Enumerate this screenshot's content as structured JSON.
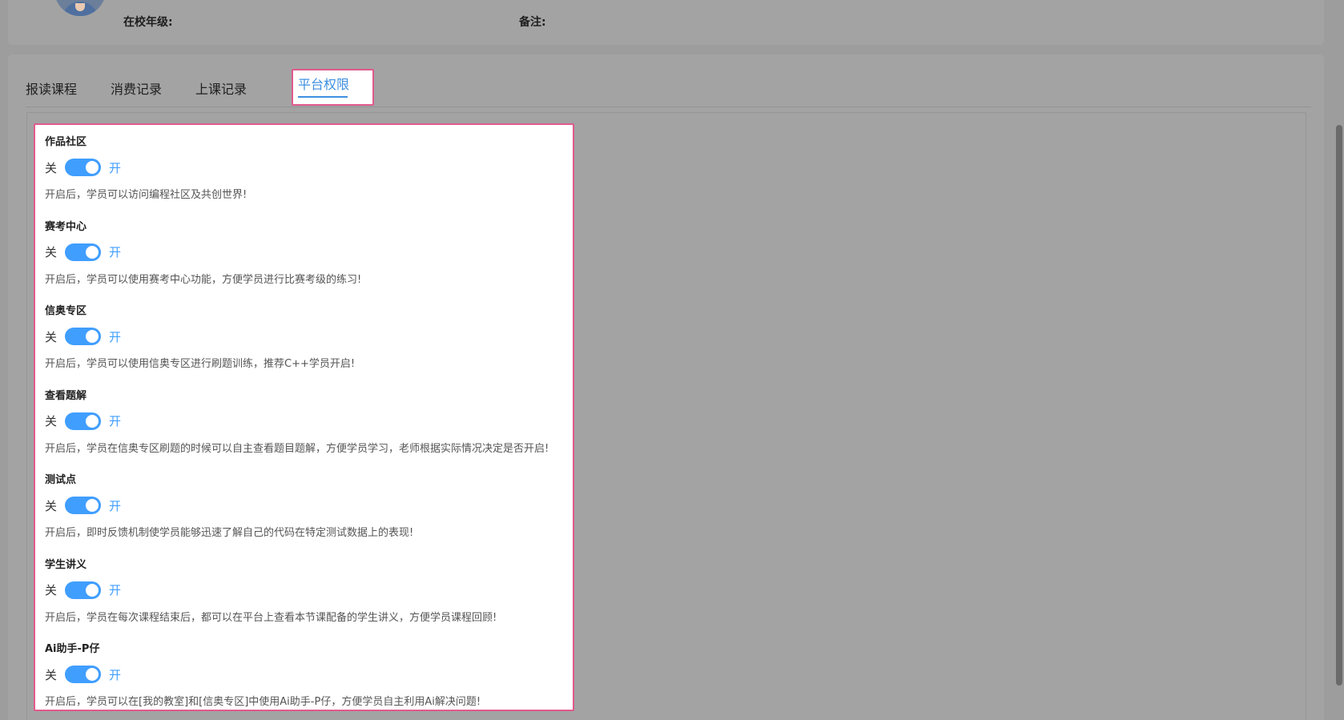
{
  "info": {
    "grade_label": "在校年级:",
    "remark_label": "备注:"
  },
  "tabs": [
    {
      "label": "报读课程"
    },
    {
      "label": "消费记录"
    },
    {
      "label": "上课记录"
    },
    {
      "label": "平台权限"
    }
  ],
  "active_tab": "平台权限",
  "switch_labels": {
    "off": "关",
    "on": "开"
  },
  "permissions": [
    {
      "title": "作品社区",
      "enabled": true,
      "desc": "开启后，学员可以访问编程社区及共创世界!"
    },
    {
      "title": "赛考中心",
      "enabled": true,
      "desc": "开启后，学员可以使用赛考中心功能，方便学员进行比赛考级的练习!"
    },
    {
      "title": "信奥专区",
      "enabled": true,
      "desc": "开启后，学员可以使用信奥专区进行刷题训练，推荐C++学员开启!"
    },
    {
      "title": "查看题解",
      "enabled": true,
      "desc": "开启后，学员在信奥专区刷题的时候可以自主查看题目题解，方便学员学习，老师根据实际情况决定是否开启!"
    },
    {
      "title": "测试点",
      "enabled": true,
      "desc": "开启后，即时反馈机制使学员能够迅速了解自己的代码在特定测试数据上的表现!"
    },
    {
      "title": "学生讲义",
      "enabled": true,
      "desc": "开启后，学员在每次课程结束后，都可以在平台上查看本节课配备的学生讲义，方便学员课程回顾!"
    },
    {
      "title": "Ai助手-P仔",
      "enabled": true,
      "desc": "开启后，学员可以在[我的教室]和[信奥专区]中使用Ai助手-P仔，方便学员自主利用Ai解决问题!"
    }
  ],
  "colors": {
    "accent": "#409eff",
    "highlight_border": "#e05a8c",
    "overlay": "#9d9d9d"
  }
}
